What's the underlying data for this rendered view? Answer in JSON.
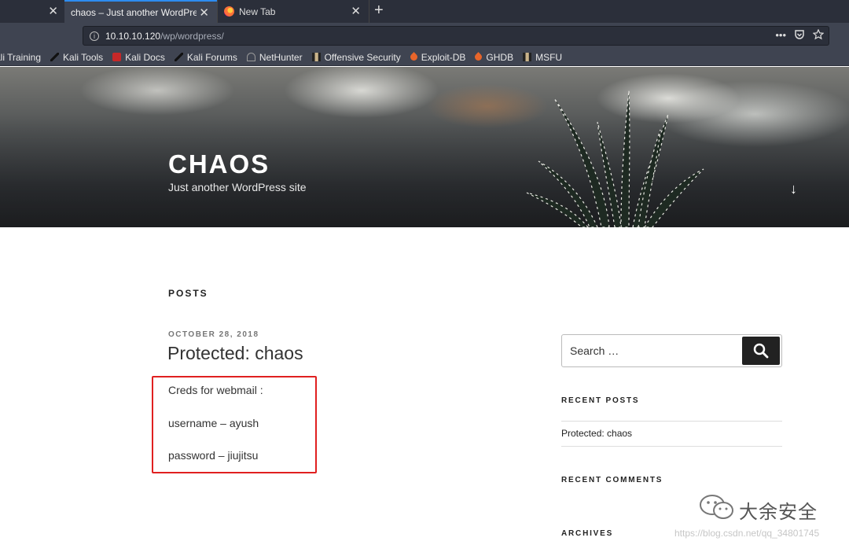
{
  "browser": {
    "tabs": [
      {
        "label": "",
        "close": "✕"
      },
      {
        "label": "chaos – Just another WordPress site",
        "close": "✕"
      },
      {
        "label": "New Tab",
        "close": "✕"
      }
    ],
    "new_tab": "+",
    "url_host": "10.10.10.120",
    "url_path": "/wp/wordpress/",
    "url_actions": [
      "•••",
      "pocket-icon",
      "star-icon"
    ],
    "bookmarks": [
      {
        "label": "ali Training",
        "icon": "none"
      },
      {
        "label": "Kali Tools",
        "icon": "kali-dragon-icon"
      },
      {
        "label": "Kali Docs",
        "icon": "kali-docs-icon"
      },
      {
        "label": "Kali Forums",
        "icon": "kali-dragon-icon"
      },
      {
        "label": "NetHunter",
        "icon": "nethunter-icon"
      },
      {
        "label": "Offensive Security",
        "icon": "offsec-icon"
      },
      {
        "label": "Exploit-DB",
        "icon": "exploitdb-icon"
      },
      {
        "label": "GHDB",
        "icon": "exploitdb-icon"
      },
      {
        "label": "MSFU",
        "icon": "offsec-icon"
      }
    ]
  },
  "site": {
    "title": "CHAOS",
    "description": "Just another WordPress site",
    "scroll_arrow": "↓"
  },
  "main": {
    "section_heading": "POSTS",
    "post": {
      "date": "OCTOBER 28, 2018",
      "title": "Protected: chaos",
      "lines": [
        "Creds for webmail :",
        "username – ayush",
        "password – jiujitsu"
      ]
    }
  },
  "sidebar": {
    "search_placeholder": "Search …",
    "recent_posts_title": "RECENT POSTS",
    "recent_posts": [
      "Protected: chaos"
    ],
    "recent_comments_title": "RECENT COMMENTS",
    "archives_title": "ARCHIVES"
  },
  "watermark": {
    "brand": "大余安全",
    "url": "https://blog.csdn.net/qq_34801745"
  },
  "colors": {
    "highlight_box": "#e02020",
    "chrome_dark": "#2b2f3a",
    "chrome": "#3f4451"
  }
}
